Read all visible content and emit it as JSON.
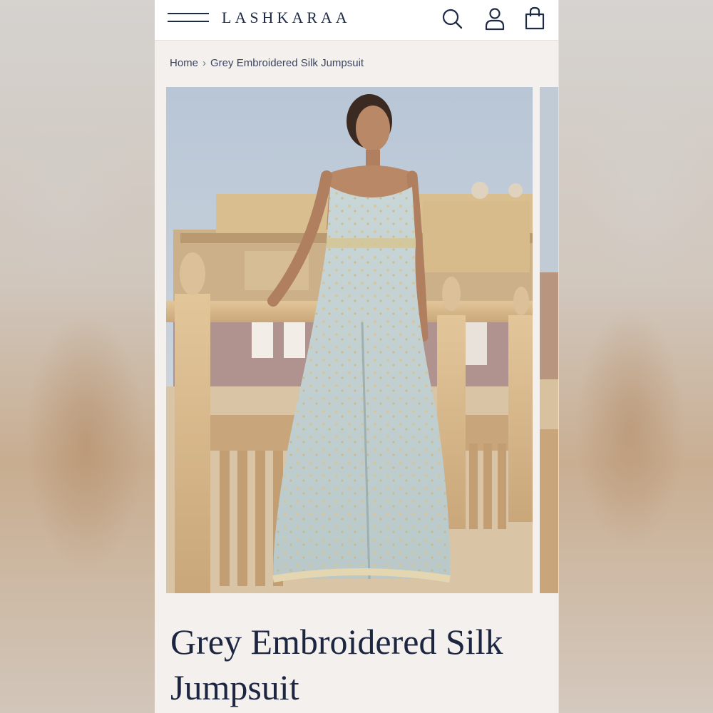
{
  "header": {
    "brand": "LASHKARAA",
    "icons": [
      "menu-icon",
      "search-icon",
      "account-icon",
      "bag-icon"
    ]
  },
  "breadcrumb": {
    "home": "Home",
    "separator": "›",
    "current": "Grey Embroidered Silk Jumpsuit"
  },
  "product": {
    "title": "Grey Embroidered Silk Jumpsuit"
  },
  "colors": {
    "brand_navy": "#1f2a44",
    "page_bg": "#f3f0ed"
  }
}
